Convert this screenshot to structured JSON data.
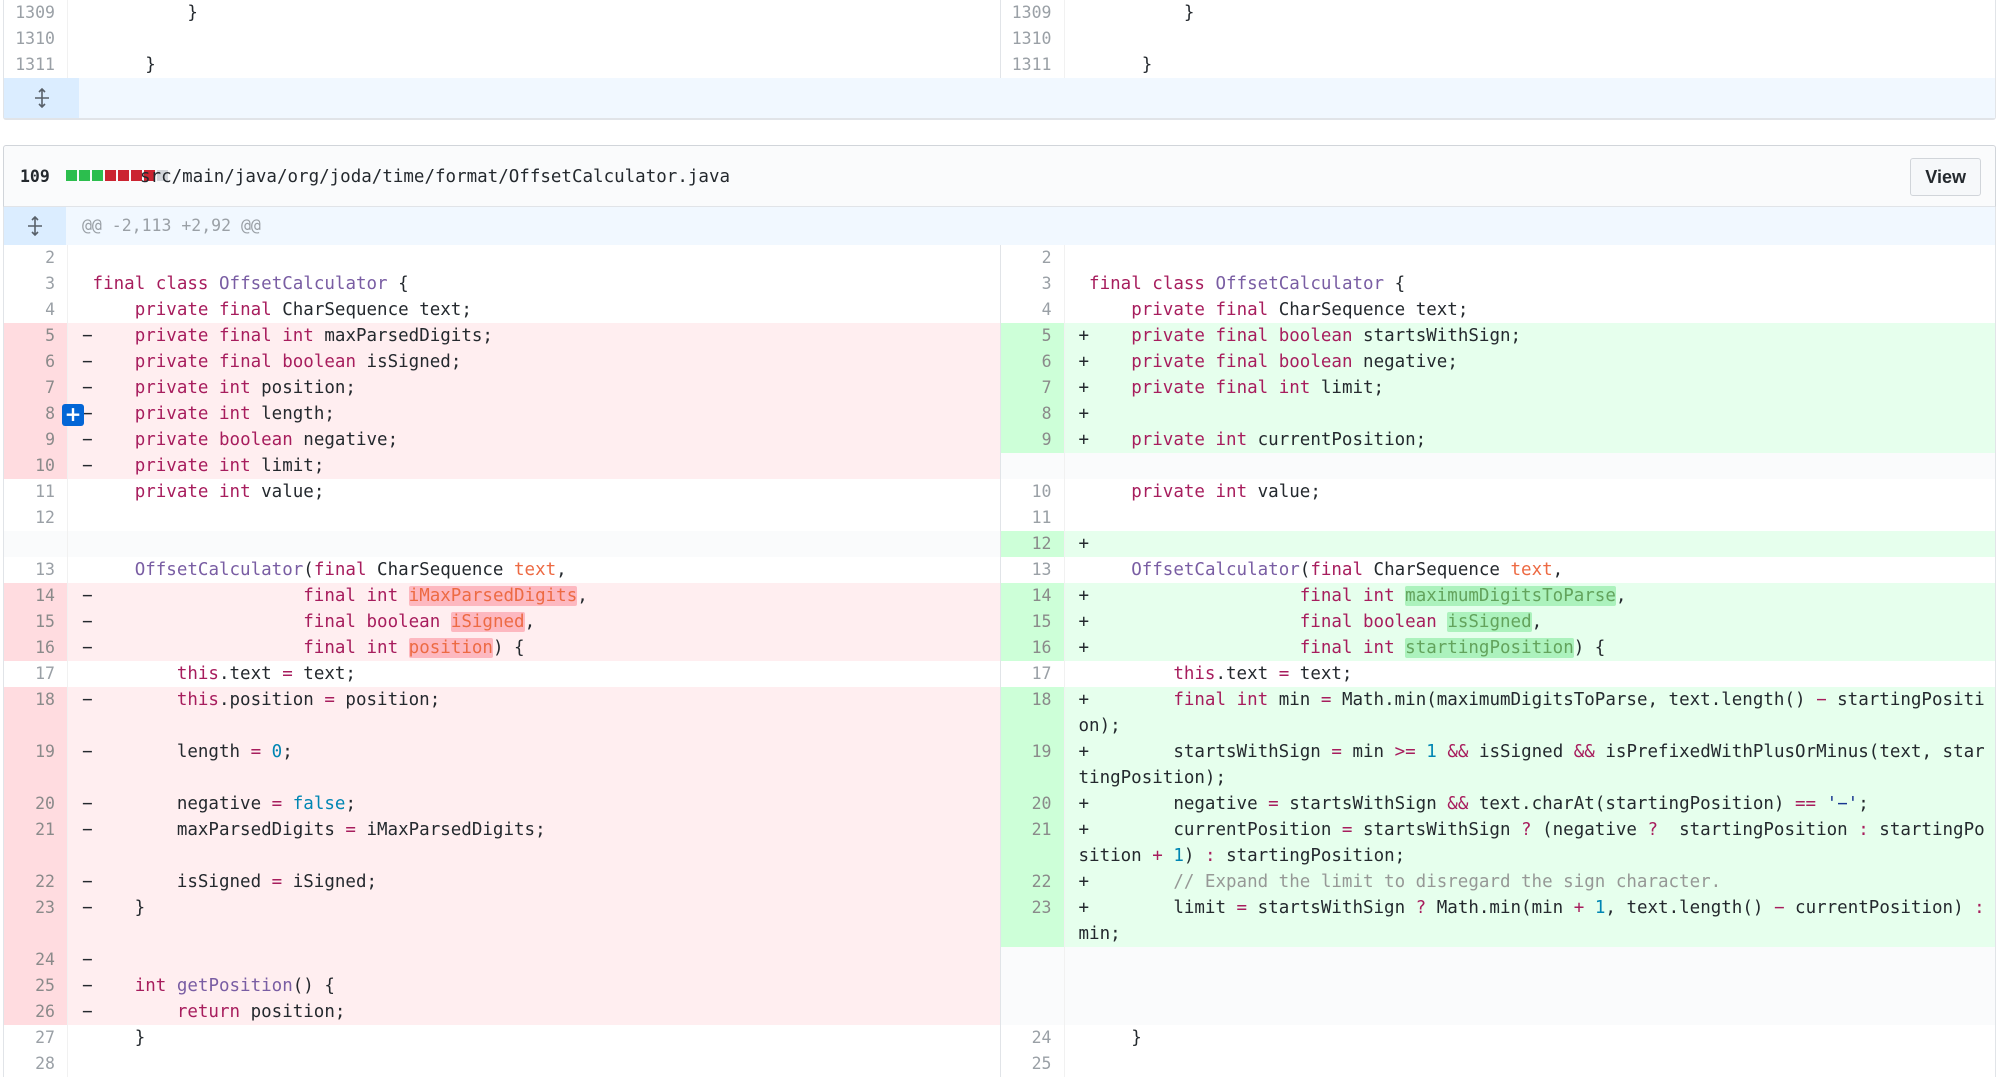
{
  "top_context": {
    "rows": [
      {
        "left_num": "1309",
        "right_num": "1309",
        "left_code": "          }",
        "right_code": "          }"
      },
      {
        "left_num": "1310",
        "right_num": "1310",
        "left_code": "",
        "right_code": ""
      },
      {
        "left_num": "1311",
        "right_num": "1311",
        "left_code": "      }",
        "right_code": "      }"
      }
    ]
  },
  "file": {
    "change_count": "109",
    "path": "src/main/java/org/joda/time/format/OffsetCalculator.java",
    "view_label": "View",
    "bar_colors": [
      "#2cbe4e",
      "#2cbe4e",
      "#2cbe4e",
      "#cb2431",
      "#cb2431",
      "#cb2431",
      "#cb2431",
      "#d1d5da"
    ],
    "hunk_header": "@@ -2,113 +2,92 @@"
  },
  "colors": {
    "deletion_bg": "#ffeef0",
    "addition_bg": "#e6ffed",
    "expand_bg": "#f1f8ff",
    "plus_button": "#0366d6"
  }
}
